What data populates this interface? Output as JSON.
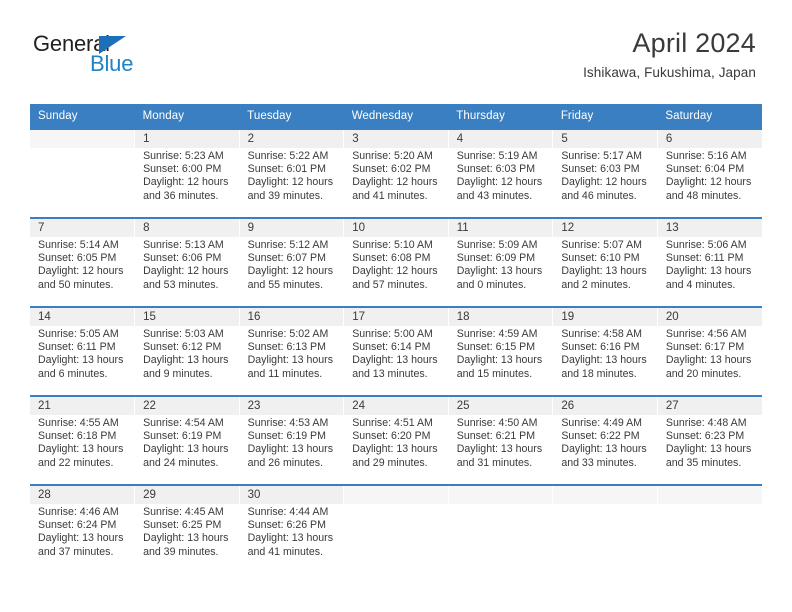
{
  "brand": {
    "name_part1": "General",
    "name_part2": "Blue",
    "triangle_color": "#1c6fb8",
    "blue_color": "#2083c8"
  },
  "header": {
    "title": "April 2024",
    "subtitle": "Ishikawa, Fukushima, Japan"
  },
  "theme": {
    "header_bg": "#3a7fc1",
    "daynum_bg": "#f0f0f0",
    "text": "#3a3a3a"
  },
  "weekdays": [
    "Sunday",
    "Monday",
    "Tuesday",
    "Wednesday",
    "Thursday",
    "Friday",
    "Saturday"
  ],
  "weeks": [
    {
      "days": [
        {
          "num": "",
          "sunrise": "",
          "sunset": "",
          "daylight1": "",
          "daylight2": ""
        },
        {
          "num": "1",
          "sunrise": "Sunrise: 5:23 AM",
          "sunset": "Sunset: 6:00 PM",
          "daylight1": "Daylight: 12 hours",
          "daylight2": "and 36 minutes."
        },
        {
          "num": "2",
          "sunrise": "Sunrise: 5:22 AM",
          "sunset": "Sunset: 6:01 PM",
          "daylight1": "Daylight: 12 hours",
          "daylight2": "and 39 minutes."
        },
        {
          "num": "3",
          "sunrise": "Sunrise: 5:20 AM",
          "sunset": "Sunset: 6:02 PM",
          "daylight1": "Daylight: 12 hours",
          "daylight2": "and 41 minutes."
        },
        {
          "num": "4",
          "sunrise": "Sunrise: 5:19 AM",
          "sunset": "Sunset: 6:03 PM",
          "daylight1": "Daylight: 12 hours",
          "daylight2": "and 43 minutes."
        },
        {
          "num": "5",
          "sunrise": "Sunrise: 5:17 AM",
          "sunset": "Sunset: 6:03 PM",
          "daylight1": "Daylight: 12 hours",
          "daylight2": "and 46 minutes."
        },
        {
          "num": "6",
          "sunrise": "Sunrise: 5:16 AM",
          "sunset": "Sunset: 6:04 PM",
          "daylight1": "Daylight: 12 hours",
          "daylight2": "and 48 minutes."
        }
      ]
    },
    {
      "days": [
        {
          "num": "7",
          "sunrise": "Sunrise: 5:14 AM",
          "sunset": "Sunset: 6:05 PM",
          "daylight1": "Daylight: 12 hours",
          "daylight2": "and 50 minutes."
        },
        {
          "num": "8",
          "sunrise": "Sunrise: 5:13 AM",
          "sunset": "Sunset: 6:06 PM",
          "daylight1": "Daylight: 12 hours",
          "daylight2": "and 53 minutes."
        },
        {
          "num": "9",
          "sunrise": "Sunrise: 5:12 AM",
          "sunset": "Sunset: 6:07 PM",
          "daylight1": "Daylight: 12 hours",
          "daylight2": "and 55 minutes."
        },
        {
          "num": "10",
          "sunrise": "Sunrise: 5:10 AM",
          "sunset": "Sunset: 6:08 PM",
          "daylight1": "Daylight: 12 hours",
          "daylight2": "and 57 minutes."
        },
        {
          "num": "11",
          "sunrise": "Sunrise: 5:09 AM",
          "sunset": "Sunset: 6:09 PM",
          "daylight1": "Daylight: 13 hours",
          "daylight2": "and 0 minutes."
        },
        {
          "num": "12",
          "sunrise": "Sunrise: 5:07 AM",
          "sunset": "Sunset: 6:10 PM",
          "daylight1": "Daylight: 13 hours",
          "daylight2": "and 2 minutes."
        },
        {
          "num": "13",
          "sunrise": "Sunrise: 5:06 AM",
          "sunset": "Sunset: 6:11 PM",
          "daylight1": "Daylight: 13 hours",
          "daylight2": "and 4 minutes."
        }
      ]
    },
    {
      "days": [
        {
          "num": "14",
          "sunrise": "Sunrise: 5:05 AM",
          "sunset": "Sunset: 6:11 PM",
          "daylight1": "Daylight: 13 hours",
          "daylight2": "and 6 minutes."
        },
        {
          "num": "15",
          "sunrise": "Sunrise: 5:03 AM",
          "sunset": "Sunset: 6:12 PM",
          "daylight1": "Daylight: 13 hours",
          "daylight2": "and 9 minutes."
        },
        {
          "num": "16",
          "sunrise": "Sunrise: 5:02 AM",
          "sunset": "Sunset: 6:13 PM",
          "daylight1": "Daylight: 13 hours",
          "daylight2": "and 11 minutes."
        },
        {
          "num": "17",
          "sunrise": "Sunrise: 5:00 AM",
          "sunset": "Sunset: 6:14 PM",
          "daylight1": "Daylight: 13 hours",
          "daylight2": "and 13 minutes."
        },
        {
          "num": "18",
          "sunrise": "Sunrise: 4:59 AM",
          "sunset": "Sunset: 6:15 PM",
          "daylight1": "Daylight: 13 hours",
          "daylight2": "and 15 minutes."
        },
        {
          "num": "19",
          "sunrise": "Sunrise: 4:58 AM",
          "sunset": "Sunset: 6:16 PM",
          "daylight1": "Daylight: 13 hours",
          "daylight2": "and 18 minutes."
        },
        {
          "num": "20",
          "sunrise": "Sunrise: 4:56 AM",
          "sunset": "Sunset: 6:17 PM",
          "daylight1": "Daylight: 13 hours",
          "daylight2": "and 20 minutes."
        }
      ]
    },
    {
      "days": [
        {
          "num": "21",
          "sunrise": "Sunrise: 4:55 AM",
          "sunset": "Sunset: 6:18 PM",
          "daylight1": "Daylight: 13 hours",
          "daylight2": "and 22 minutes."
        },
        {
          "num": "22",
          "sunrise": "Sunrise: 4:54 AM",
          "sunset": "Sunset: 6:19 PM",
          "daylight1": "Daylight: 13 hours",
          "daylight2": "and 24 minutes."
        },
        {
          "num": "23",
          "sunrise": "Sunrise: 4:53 AM",
          "sunset": "Sunset: 6:19 PM",
          "daylight1": "Daylight: 13 hours",
          "daylight2": "and 26 minutes."
        },
        {
          "num": "24",
          "sunrise": "Sunrise: 4:51 AM",
          "sunset": "Sunset: 6:20 PM",
          "daylight1": "Daylight: 13 hours",
          "daylight2": "and 29 minutes."
        },
        {
          "num": "25",
          "sunrise": "Sunrise: 4:50 AM",
          "sunset": "Sunset: 6:21 PM",
          "daylight1": "Daylight: 13 hours",
          "daylight2": "and 31 minutes."
        },
        {
          "num": "26",
          "sunrise": "Sunrise: 4:49 AM",
          "sunset": "Sunset: 6:22 PM",
          "daylight1": "Daylight: 13 hours",
          "daylight2": "and 33 minutes."
        },
        {
          "num": "27",
          "sunrise": "Sunrise: 4:48 AM",
          "sunset": "Sunset: 6:23 PM",
          "daylight1": "Daylight: 13 hours",
          "daylight2": "and 35 minutes."
        }
      ]
    },
    {
      "days": [
        {
          "num": "28",
          "sunrise": "Sunrise: 4:46 AM",
          "sunset": "Sunset: 6:24 PM",
          "daylight1": "Daylight: 13 hours",
          "daylight2": "and 37 minutes."
        },
        {
          "num": "29",
          "sunrise": "Sunrise: 4:45 AM",
          "sunset": "Sunset: 6:25 PM",
          "daylight1": "Daylight: 13 hours",
          "daylight2": "and 39 minutes."
        },
        {
          "num": "30",
          "sunrise": "Sunrise: 4:44 AM",
          "sunset": "Sunset: 6:26 PM",
          "daylight1": "Daylight: 13 hours",
          "daylight2": "and 41 minutes."
        },
        {
          "num": "",
          "sunrise": "",
          "sunset": "",
          "daylight1": "",
          "daylight2": ""
        },
        {
          "num": "",
          "sunrise": "",
          "sunset": "",
          "daylight1": "",
          "daylight2": ""
        },
        {
          "num": "",
          "sunrise": "",
          "sunset": "",
          "daylight1": "",
          "daylight2": ""
        },
        {
          "num": "",
          "sunrise": "",
          "sunset": "",
          "daylight1": "",
          "daylight2": ""
        }
      ]
    }
  ]
}
